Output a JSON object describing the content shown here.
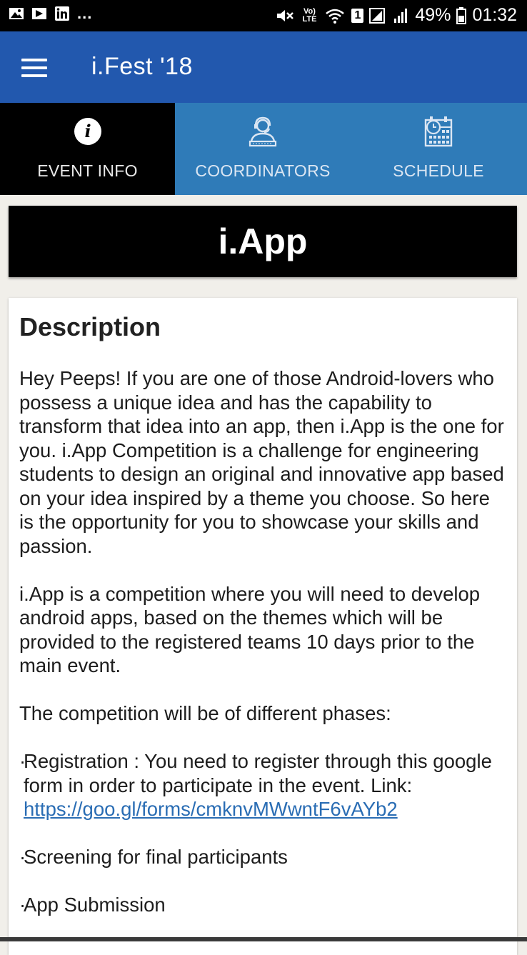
{
  "status_bar": {
    "notification_overflow": "...",
    "battery_percent": "49%",
    "time": "01:32",
    "volte_label": "Vo) LTE",
    "sim_slot": "1"
  },
  "app_bar": {
    "title": "i.Fest '18",
    "color": "#2258ae"
  },
  "tabs": [
    {
      "label": "EVENT INFO",
      "icon": "info-icon",
      "active": true
    },
    {
      "label": "COORDINATORS",
      "icon": "support-agent-icon",
      "active": false
    },
    {
      "label": "SCHEDULE",
      "icon": "calendar-clock-icon",
      "active": false
    }
  ],
  "event": {
    "name": "i.App"
  },
  "description": {
    "heading": "Description",
    "para1": "Hey Peeps! If you are one of those Android-lovers who possess a unique idea and has the capability to transform that idea into an app, then i.App is the one for you. i.App Competition is a challenge for engineering students to design an original and innovative app based on your idea inspired by a theme you choose. So here is the opportunity for you to showcase your skills and passion.",
    "para2": "i.App is a competition where you will need to develop android apps, based on the themes which will be provided to the registered teams 10 days prior to the main event.",
    "para3": "The competition will be of different phases:",
    "bullet_symbol": "·",
    "phase1_text": "Registration : You need to register through this google form in order to participate in the event. Link:",
    "phase1_link": "https://goo.gl/forms/cmknvMWwntF6vAYb2",
    "phase2": "Screening for final participants",
    "phase3": "App Submission"
  }
}
